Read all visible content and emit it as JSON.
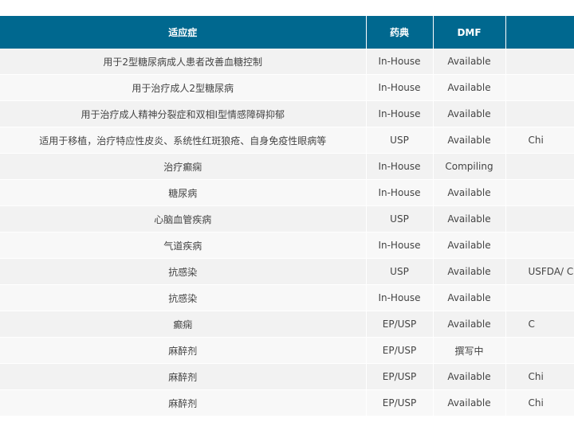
{
  "table": {
    "headers": [
      "适应症",
      "药典",
      "DMF",
      ""
    ],
    "rows": [
      [
        "用于2型糖尿病成人患者改善血糖控制",
        "In-House",
        "Available",
        ""
      ],
      [
        "用于治疗成人2型糖尿病",
        "In-House",
        "Available",
        ""
      ],
      [
        "用于治疗成人精神分裂症和双相I型情感障碍抑郁",
        "In-House",
        "Available",
        ""
      ],
      [
        "适用于移植，治疗特应性皮炎、系统性红斑狼疮、自身免疫性眼病等",
        "USP",
        "Available",
        "Chi"
      ],
      [
        "治疗癫痫",
        "In-House",
        "Compiling",
        ""
      ],
      [
        "糖尿病",
        "In-House",
        "Available",
        ""
      ],
      [
        "心脑血管疾病",
        "USP",
        "Available",
        ""
      ],
      [
        "气道疾病",
        "In-House",
        "Available",
        ""
      ],
      [
        "抗感染",
        "USP",
        "Available",
        "USFDA/ Cl"
      ],
      [
        "抗感染",
        "In-House",
        "Available",
        ""
      ],
      [
        "癫痫",
        "EP/USP",
        "Available",
        "C"
      ],
      [
        "麻醉剂",
        "EP/USP",
        "撰写中",
        ""
      ],
      [
        "麻醉剂",
        "EP/USP",
        "Available",
        "Chi"
      ],
      [
        "麻醉剂",
        "EP/USP",
        "Available",
        "Chi"
      ]
    ]
  }
}
